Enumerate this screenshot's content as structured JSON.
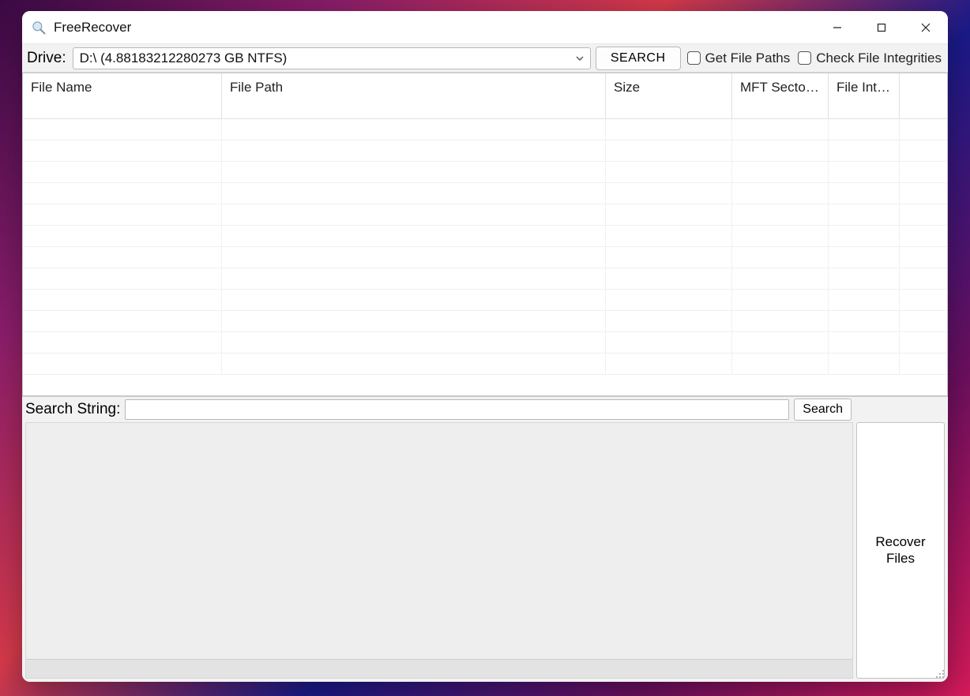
{
  "window": {
    "title": "FreeRecover"
  },
  "toolbar": {
    "drive_label": "Drive:",
    "drive_value": "D:\\ (4.88183212280273 GB NTFS)",
    "search_button": "SEARCH",
    "get_file_paths": "Get File Paths",
    "check_file_integrities": "Check File Integrities"
  },
  "table": {
    "columns": [
      "File Name",
      "File Path",
      "Size",
      "MFT Sector ...",
      "File Inte..."
    ],
    "rows": []
  },
  "search_panel": {
    "label": "Search String:",
    "value": "",
    "button": "Search"
  },
  "recover_button": "Recover Files"
}
